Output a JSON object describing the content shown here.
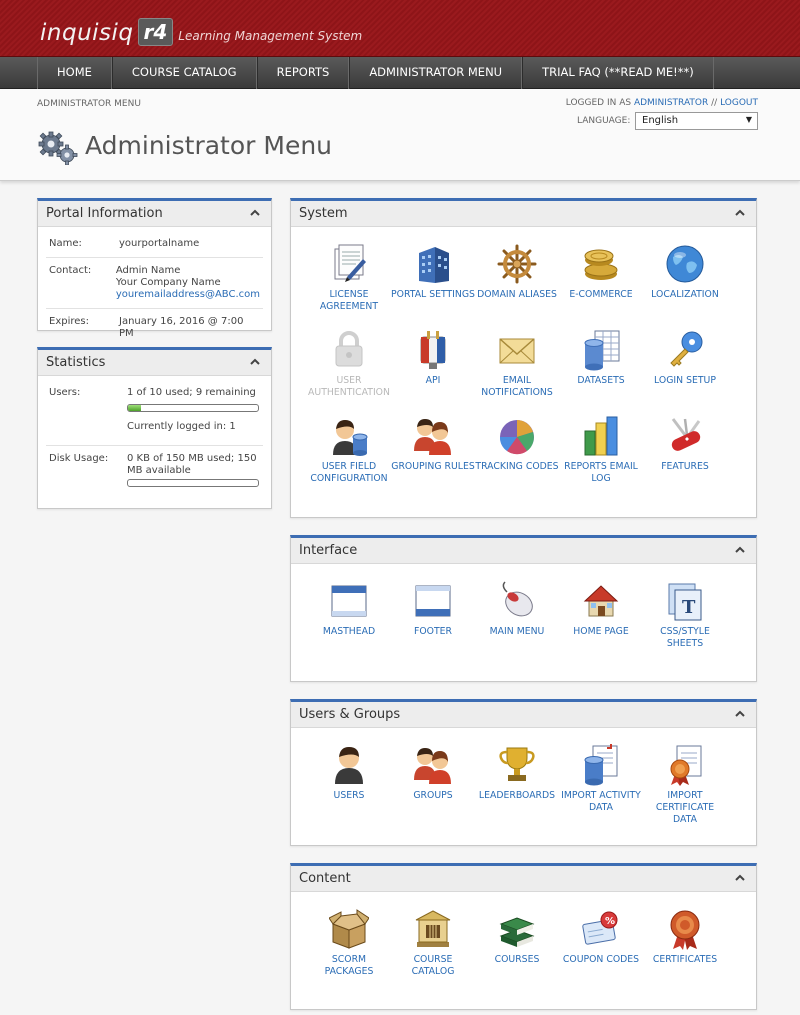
{
  "app": {
    "logo_text": "inquisiq",
    "logo_badge": "r4",
    "logo_subtitle": "Learning Management System"
  },
  "nav": {
    "items": [
      {
        "label": "HOME"
      },
      {
        "label": "COURSE CATALOG"
      },
      {
        "label": "REPORTS"
      },
      {
        "label": "ADMINISTRATOR MENU"
      },
      {
        "label": "TRIAL FAQ (**READ ME!**)"
      }
    ]
  },
  "header": {
    "breadcrumb": "ADMINISTRATOR MENU",
    "logged_in_prefix": "LOGGED IN AS",
    "logged_in_user": "ADMINISTRATOR",
    "separator": "//",
    "logout": "LOGOUT",
    "language_label": "LANGUAGE:",
    "language_value": "English",
    "page_title": "Administrator Menu"
  },
  "portal_info": {
    "title": "Portal Information",
    "name_label": "Name:",
    "name_value": "yourportalname",
    "contact_label": "Contact:",
    "contact_name": "Admin Name",
    "contact_company": "Your Company Name",
    "contact_email": "youremailaddress@ABC.com",
    "expires_label": "Expires:",
    "expires_value": "January 16, 2016 @ 7:00 PM"
  },
  "statistics": {
    "title": "Statistics",
    "users_label": "Users:",
    "users_value": "1 of 10 used; 9 remaining",
    "users_progress": 0.1,
    "logged_in": "Currently logged in: 1",
    "disk_label": "Disk Usage:",
    "disk_value": "0 KB of 150 MB used; 150 MB available",
    "disk_progress": 0
  },
  "sections": {
    "system": {
      "title": "System",
      "items": [
        {
          "label": "LICENSE AGREEMENT",
          "icon": "license-icon"
        },
        {
          "label": "PORTAL SETTINGS",
          "icon": "building-icon"
        },
        {
          "label": "DOMAIN ALIASES",
          "icon": "ship-wheel-icon"
        },
        {
          "label": "E-COMMERCE",
          "icon": "coins-icon"
        },
        {
          "label": "LOCALIZATION",
          "icon": "globe-icon"
        },
        {
          "label": "USER AUTHENTICATION",
          "icon": "padlock-icon"
        },
        {
          "label": "API",
          "icon": "plug-icon"
        },
        {
          "label": "EMAIL NOTIFICATIONS",
          "icon": "envelope-icon"
        },
        {
          "label": "DATASETS",
          "icon": "database-icon"
        },
        {
          "label": "LOGIN SETUP",
          "icon": "key-icon"
        },
        {
          "label": "USER FIELD CONFIGURATION",
          "icon": "user-database-icon"
        },
        {
          "label": "GROUPING RULES",
          "icon": "group-icon"
        },
        {
          "label": "TRACKING CODES",
          "icon": "pie-chart-icon"
        },
        {
          "label": "REPORTS EMAIL LOG",
          "icon": "bar-chart-icon"
        },
        {
          "label": "FEATURES",
          "icon": "swiss-knife-icon"
        }
      ]
    },
    "interface": {
      "title": "Interface",
      "items": [
        {
          "label": "MASTHEAD",
          "icon": "window-top-icon"
        },
        {
          "label": "FOOTER",
          "icon": "window-bottom-icon"
        },
        {
          "label": "MAIN MENU",
          "icon": "mouse-icon"
        },
        {
          "label": "HOME PAGE",
          "icon": "house-icon"
        },
        {
          "label": "CSS/STYLE SHEETS",
          "icon": "style-sheet-icon"
        }
      ]
    },
    "users_groups": {
      "title": "Users & Groups",
      "items": [
        {
          "label": "USERS",
          "icon": "user-icon"
        },
        {
          "label": "GROUPS",
          "icon": "group-icon"
        },
        {
          "label": "LEADERBOARDS",
          "icon": "trophy-icon"
        },
        {
          "label": "IMPORT ACTIVITY DATA",
          "icon": "import-data-icon"
        },
        {
          "label": "IMPORT CERTIFICATE DATA",
          "icon": "certificate-import-icon"
        }
      ]
    },
    "content": {
      "title": "Content",
      "items": [
        {
          "label": "SCORM PACKAGES",
          "icon": "package-icon"
        },
        {
          "label": "COURSE CATALOG",
          "icon": "library-icon"
        },
        {
          "label": "COURSES",
          "icon": "books-icon"
        },
        {
          "label": "COUPON CODES",
          "icon": "coupon-icon"
        },
        {
          "label": "CERTIFICATES",
          "icon": "certificate-icon"
        }
      ]
    }
  }
}
